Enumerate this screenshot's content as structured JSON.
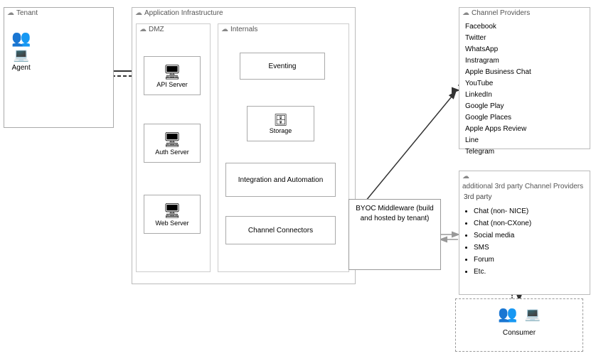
{
  "tenant": {
    "title": "Tenant",
    "agent_label": "Agent"
  },
  "app_infra": {
    "title": "Application Infrastructure",
    "dmz": {
      "title": "DMZ",
      "api_server": "API Server",
      "auth_server": "Auth Server",
      "web_server": "Web Server"
    },
    "internals": {
      "title": "Internals",
      "eventing": "Eventing",
      "storage": "Storage",
      "integration": "Integration and Automation",
      "channel_connectors": "Channel Connectors"
    }
  },
  "channel_providers": {
    "title": "Channel Providers",
    "items": [
      "Facebook",
      "Twitter",
      "WhatsApp",
      "Instragram",
      "Apple Business Chat",
      "YouTube",
      "LinkedIn",
      "Google Play",
      "Google Places",
      "Apple Apps Review",
      "Line",
      "Telegram"
    ]
  },
  "additional_providers": {
    "title": "additional 3rd party Channel Providers",
    "third_party_label": "3rd party",
    "items": [
      "Chat (non- NICE)",
      "Chat (non-CXone)",
      "Social media",
      "SMS",
      "Forum",
      "Etc."
    ]
  },
  "byoc": {
    "title": "BYOC Middleware (build and hosted by tenant)"
  },
  "consumer": {
    "title": "Consumer"
  }
}
